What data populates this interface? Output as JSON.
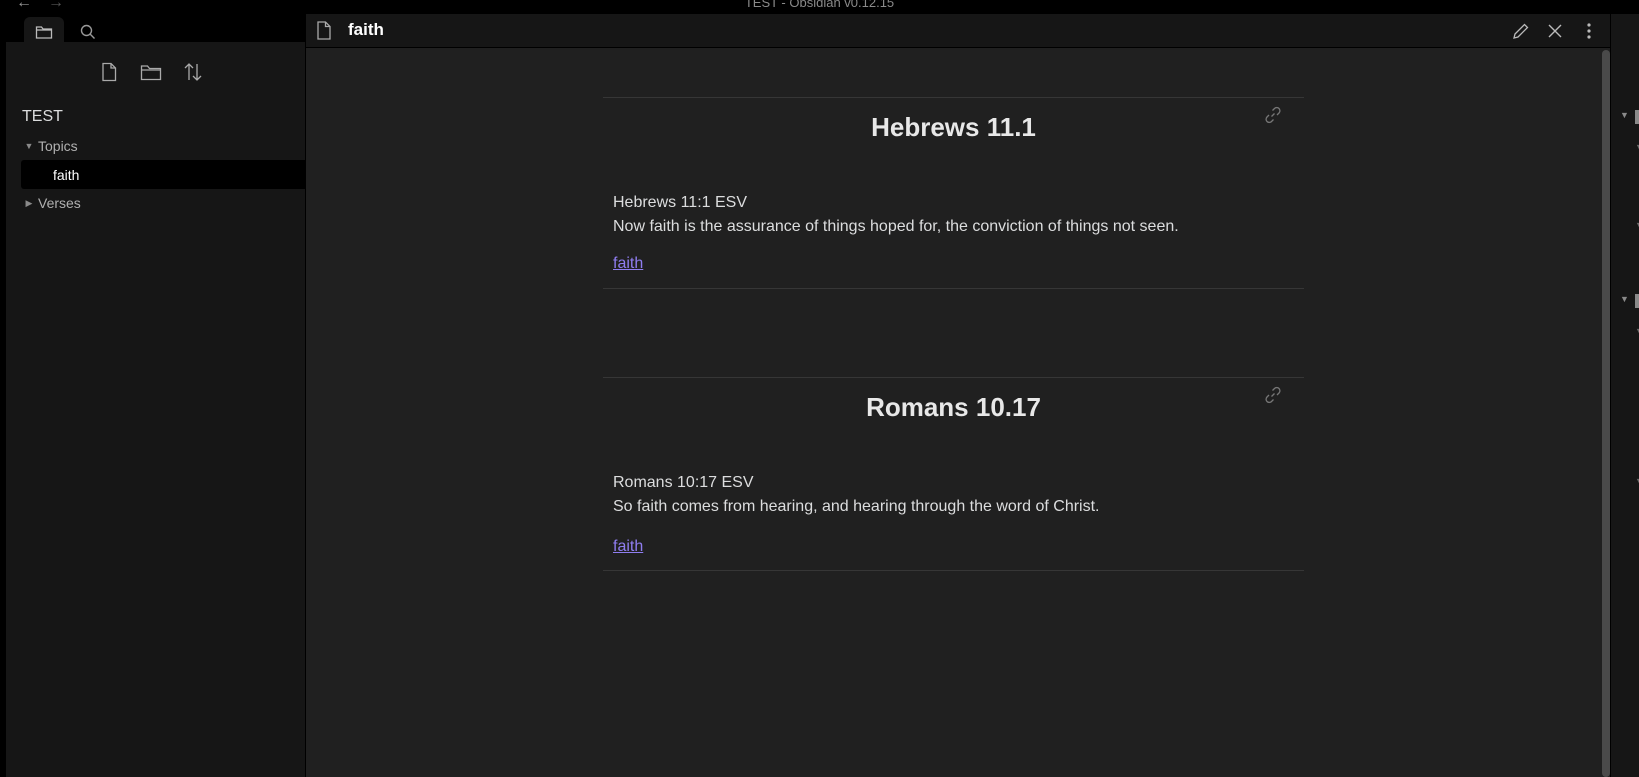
{
  "window": {
    "title": "TEST - Obsidian v0.12.15",
    "back_arrow": "←",
    "forward_arrow": "→"
  },
  "sidebar": {
    "vault_name": "TEST",
    "tree": [
      {
        "label": "Topics",
        "expanded": true
      },
      {
        "label": "Verses",
        "expanded": false
      }
    ],
    "active_file": "faith",
    "tab_icons": [
      "folder-icon",
      "search-icon"
    ],
    "action_icons": [
      "new-note-icon",
      "new-folder-icon",
      "sort-icon"
    ]
  },
  "pane": {
    "title": "faith",
    "action_icons": [
      "edit-icon",
      "close-icon",
      "more-options-icon"
    ]
  },
  "embeds": [
    {
      "heading": "Hebrews 11.1",
      "reference": "Hebrews 11:1 ESV",
      "text": "Now faith is the assurance of things hoped for, the conviction of things not seen.",
      "tag": "faith"
    },
    {
      "heading": "Romans 10.17",
      "reference": "Romans 10:17 ESV",
      "text": "So faith comes from hearing, and hearing through the word of Christ.",
      "tag": "faith"
    }
  ],
  "colors": {
    "background": "#202020",
    "sidebar": "#161616",
    "accent_link": "#8f7df0",
    "text": "#dcddde"
  }
}
